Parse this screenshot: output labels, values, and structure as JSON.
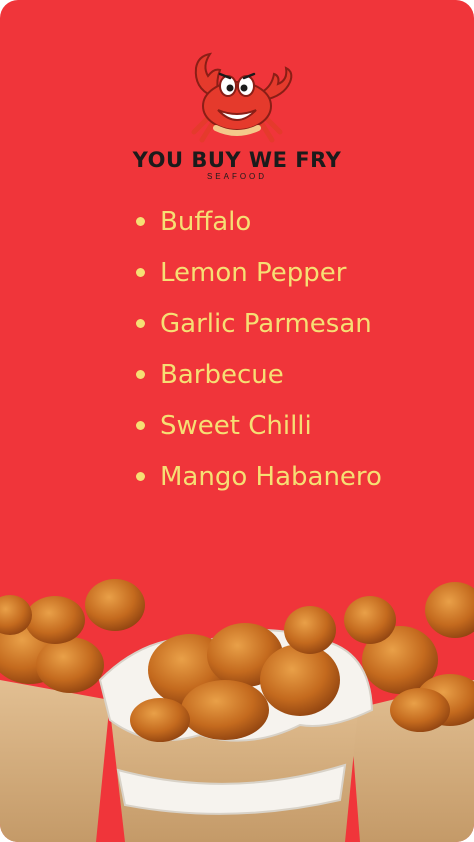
{
  "brand": {
    "name": "YOU BUY WE FRY",
    "tagline": "SEAFOOD",
    "logo_icon": "crab-mascot"
  },
  "flavors": [
    "Buffalo",
    "Lemon Pepper",
    "Garlic Parmesan",
    "Barbecue",
    "Sweet Chilli",
    "Mango Habanero"
  ],
  "colors": {
    "background": "#f0353a",
    "flavor_text": "#f6df74",
    "brand_text": "#1b1b1b"
  },
  "photo": {
    "subject": "fried chicken in paper boxes"
  }
}
